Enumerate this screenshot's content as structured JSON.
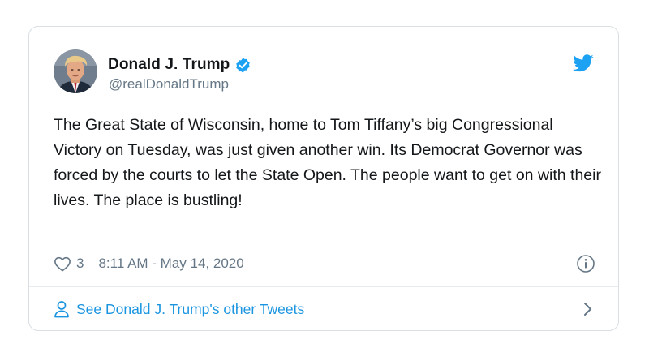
{
  "tweet": {
    "author_name": "Donald J. Trump",
    "handle": "@realDonaldTrump",
    "text": "The Great State of Wisconsin, home to Tom Tiffany’s big Congressional Victory on Tuesday, was just given another win. Its Democrat Governor was forced by the courts to let the State Open. The people want to get on with their lives. The place is bustling!",
    "like_count": "3",
    "timestamp": "8:11 AM - May 14, 2020"
  },
  "footer": {
    "link_label": "See Donald J. Trump's other Tweets"
  },
  "icons": {
    "avatar": "profile-photo",
    "verified": "verified-badge-icon",
    "brand": "twitter-bird-icon",
    "like": "heart-icon",
    "info": "info-icon",
    "person": "person-icon",
    "chevron": "chevron-right-icon"
  },
  "colors": {
    "link": "#1b95e0",
    "verified": "#1da1f2",
    "text": "#14171a",
    "muted": "#657786",
    "border": "#d9dfe3"
  }
}
